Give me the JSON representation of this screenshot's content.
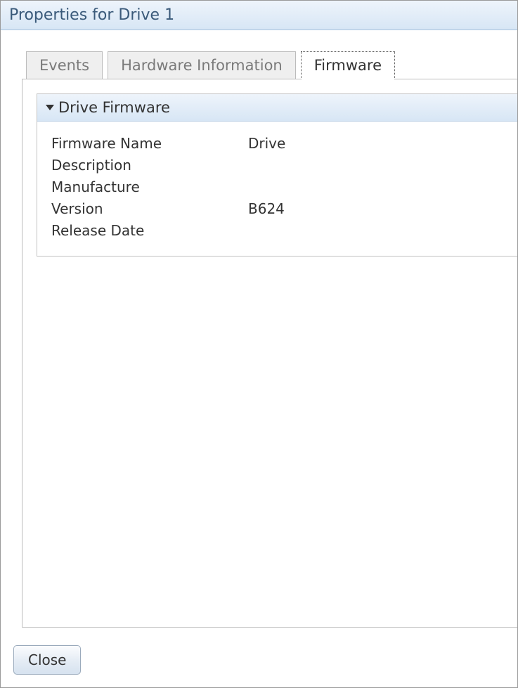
{
  "window": {
    "title": "Properties for Drive 1"
  },
  "tabs": {
    "events": "Events",
    "hardware_info": "Hardware Information",
    "firmware": "Firmware"
  },
  "section": {
    "title": "Drive Firmware"
  },
  "properties": {
    "firmware_name": {
      "label": "Firmware Name",
      "value": "Drive"
    },
    "description": {
      "label": "Description",
      "value": ""
    },
    "manufacture": {
      "label": "Manufacture",
      "value": ""
    },
    "version": {
      "label": "Version",
      "value": "B624"
    },
    "release_date": {
      "label": "Release Date",
      "value": ""
    }
  },
  "buttons": {
    "close": "Close"
  }
}
